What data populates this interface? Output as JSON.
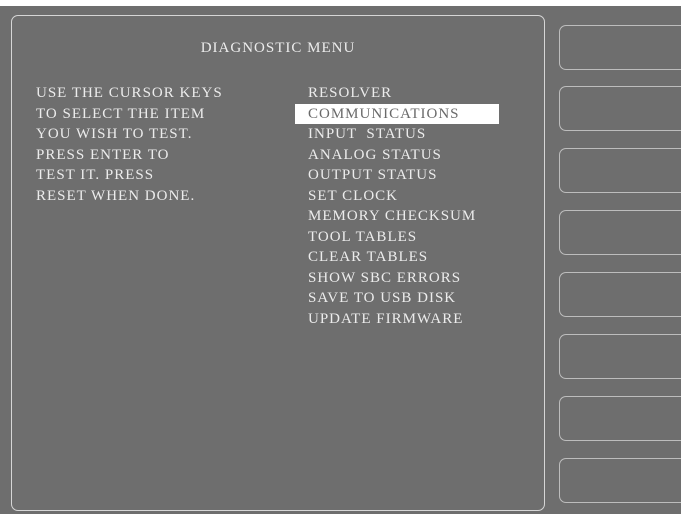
{
  "screen": {
    "title": "DIAGNOSTIC MENU",
    "instructions": [
      "USE THE CURSOR KEYS",
      "TO SELECT THE ITEM",
      "YOU WISH TO TEST.",
      "PRESS ENTER TO",
      "TEST IT. PRESS",
      "RESET WHEN DONE."
    ],
    "menu_items": [
      "RESOLVER",
      "COMMUNICATIONS",
      "INPUT  STATUS",
      "ANALOG STATUS",
      "OUTPUT STATUS",
      "SET CLOCK",
      "MEMORY CHECKSUM",
      "TOOL TABLES",
      "CLEAR TABLES",
      "SHOW SBC ERRORS",
      "SAVE TO USB DISK",
      "UPDATE FIRMWARE"
    ],
    "selected_index": 1
  },
  "softkeys": [
    "",
    "",
    "",
    "",
    "",
    "",
    "",
    ""
  ],
  "colors": {
    "background": "#6e6e6e",
    "text": "#ececec",
    "highlight": "#ffffff",
    "highlight_text": "#6a6a6a"
  }
}
